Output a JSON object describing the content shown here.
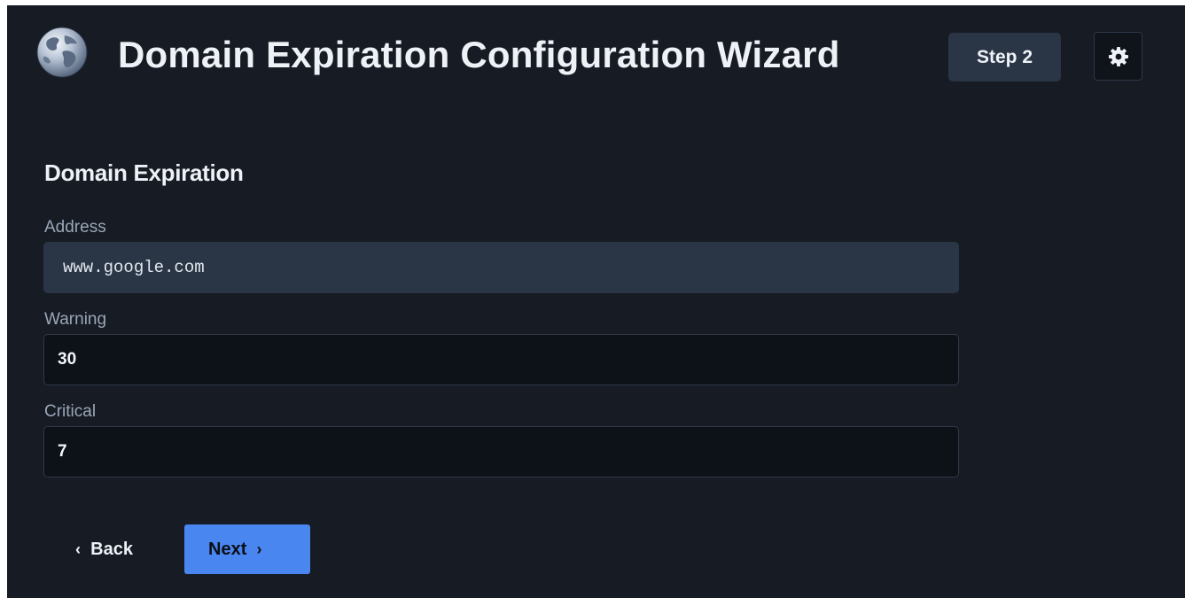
{
  "header": {
    "title": "Domain Expiration Configuration Wizard",
    "step_label": "Step 2",
    "logo_icon": "globe-icon",
    "settings_icon": "gear-icon"
  },
  "section": {
    "title": "Domain Expiration"
  },
  "fields": {
    "address": {
      "label": "Address",
      "value": "www.google.com"
    },
    "warning": {
      "label": "Warning",
      "value": "30"
    },
    "critical": {
      "label": "Critical",
      "value": "7"
    }
  },
  "footer": {
    "back_label": "Back",
    "next_label": "Next",
    "back_icon": "chevron-left-icon",
    "next_icon": "chevron-right-icon"
  },
  "colors": {
    "background": "#171b24",
    "accent": "#4a86f0",
    "badge": "#2a3546",
    "input_background": "#0d1118"
  }
}
